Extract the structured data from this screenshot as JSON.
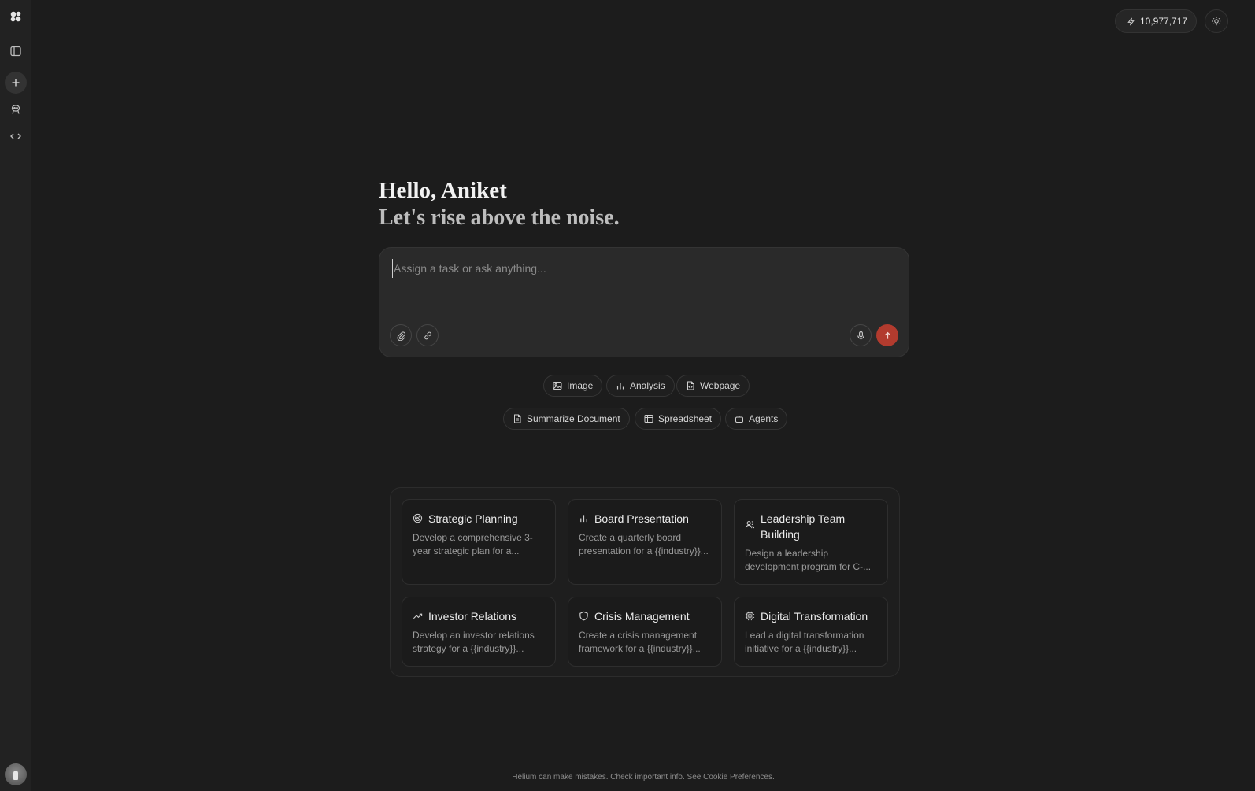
{
  "header": {
    "credits": "10,977,717"
  },
  "greeting": {
    "title": "Hello, Aniket",
    "subtitle": "Let's rise above the noise."
  },
  "composer": {
    "placeholder": "Assign a task or ask anything..."
  },
  "chips": [
    {
      "label": "Image",
      "icon": "image-icon"
    },
    {
      "label": "Analysis",
      "icon": "bar-chart-icon"
    },
    {
      "label": "Webpage",
      "icon": "file-code-icon"
    },
    {
      "label": "Summarize Document",
      "icon": "document-icon"
    },
    {
      "label": "Spreadsheet",
      "icon": "table-icon"
    },
    {
      "label": "Agents",
      "icon": "robot-icon"
    }
  ],
  "cards": [
    {
      "title": "Strategic Planning",
      "desc": "Develop a comprehensive 3-year strategic plan for a...",
      "icon": "target-icon"
    },
    {
      "title": "Board Presentation",
      "desc": "Create a quarterly board presentation for a {{industry}}...",
      "icon": "bar-chart-icon"
    },
    {
      "title": "Leadership Team Building",
      "desc": "Design a leadership development program for C-...",
      "icon": "users-icon"
    },
    {
      "title": "Investor Relations",
      "desc": "Develop an investor relations strategy for a {{industry}}...",
      "icon": "trending-up-icon"
    },
    {
      "title": "Crisis Management",
      "desc": "Create a crisis management framework for a {{industry}}...",
      "icon": "shield-icon"
    },
    {
      "title": "Digital Transformation",
      "desc": "Lead a digital transformation initiative for a {{industry}}...",
      "icon": "cpu-icon"
    }
  ],
  "footer": {
    "text": "Helium can make mistakes. Check important info. See Cookie Preferences."
  },
  "colors": {
    "background": "#1c1c1c",
    "sidebar": "#222222",
    "send_accent": "#b23b2e"
  }
}
